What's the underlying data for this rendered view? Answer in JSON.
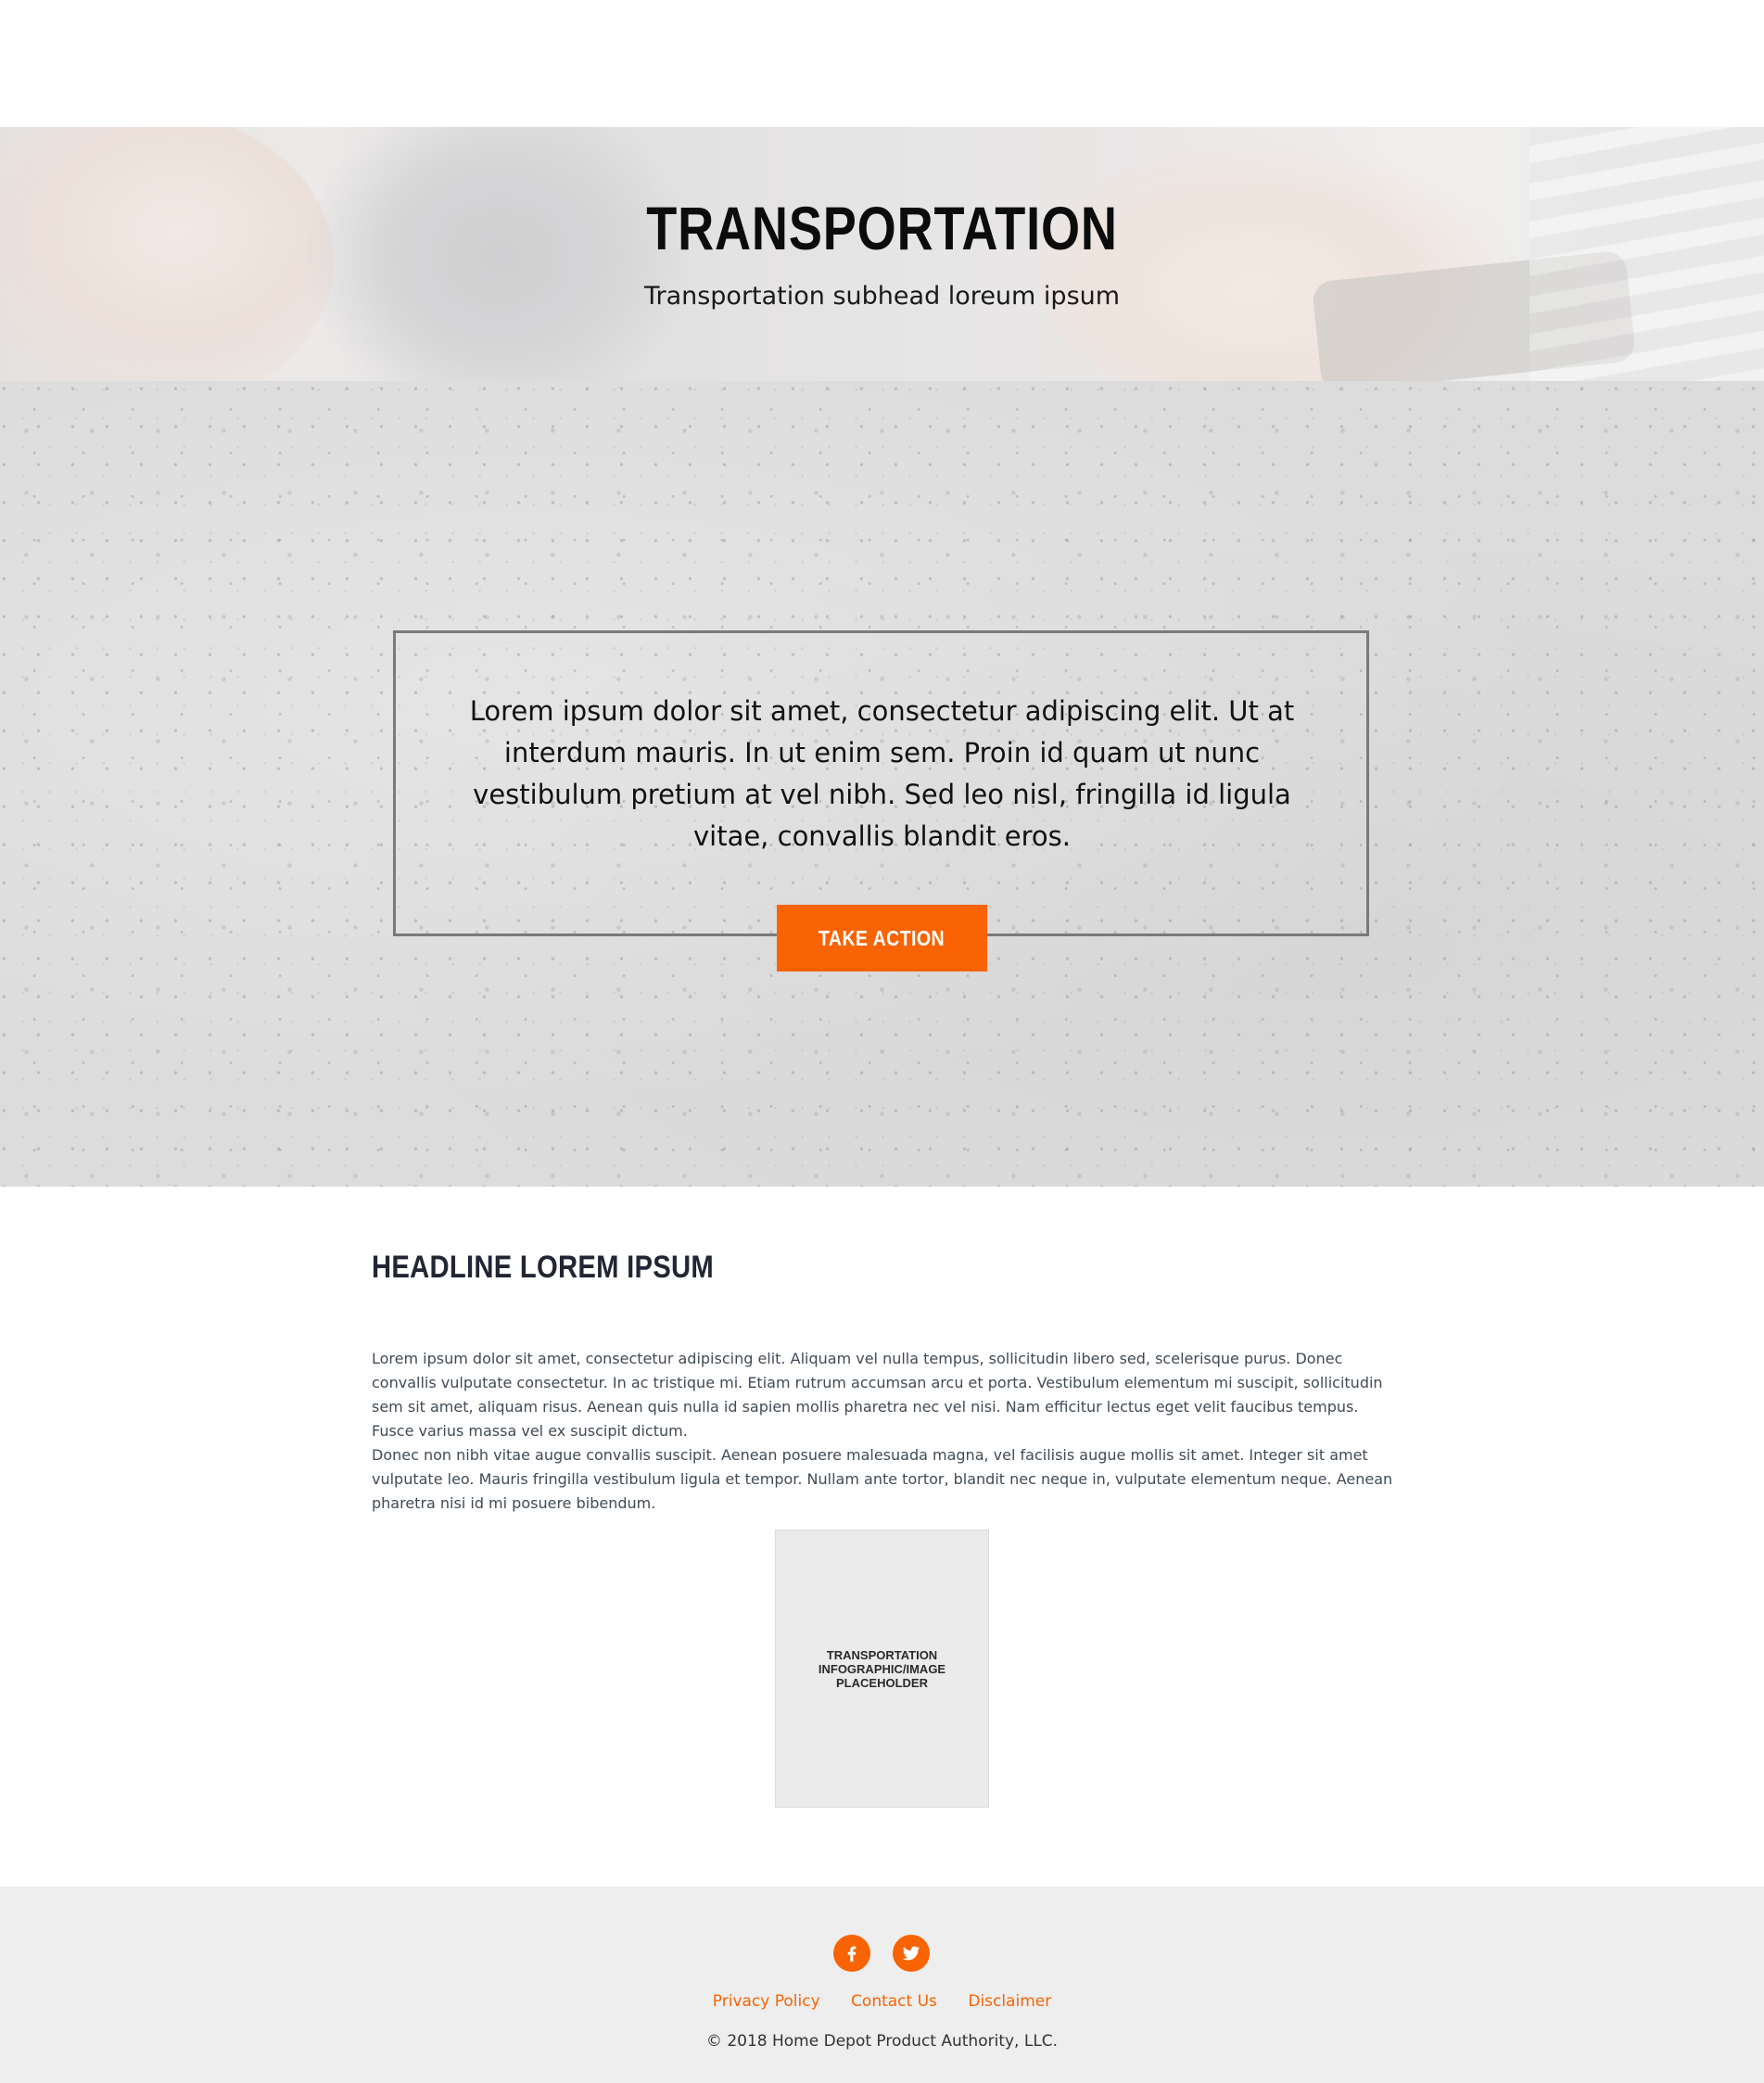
{
  "hero": {
    "title": "TRANSPORTATION",
    "subtitle": "Transportation subhead loreum ipsum"
  },
  "callout": {
    "text": "Lorem ipsum dolor sit amet, consectetur adipiscing elit. Ut at interdum mauris. In ut enim sem. Proin id quam ut nunc vestibulum pretium at vel nibh. Sed leo nisl, fringilla id ligula vitae, convallis blandit eros.",
    "button_label": "TAKE ACTION"
  },
  "content": {
    "headline": "HEADLINE LOREM IPSUM",
    "paragraphs": [
      "Lorem ipsum dolor sit amet, consectetur adipiscing elit. Aliquam vel nulla tempus, sollicitudin libero sed, scelerisque purus. Donec convallis vulputate consectetur. In ac tristique mi. Etiam rutrum accumsan arcu et porta. Vestibulum elementum mi suscipit, sollicitudin sem sit amet, aliquam risus. Aenean quis nulla id sapien mollis pharetra nec vel nisi. Nam efficitur lectus eget velit faucibus tempus. Fusce varius massa vel ex suscipit dictum.",
      "Donec non nibh vitae augue convallis suscipit. Aenean posuere malesuada magna, vel facilisis augue mollis sit amet. Integer sit amet vulputate leo. Mauris fringilla vestibulum ligula et tempor. Nullam ante tortor, blandit nec neque in, vulputate elementum neque. Aenean pharetra nisi id mi posuere bibendum."
    ],
    "image_placeholder": "TRANSPORTATION INFOGRAPHIC/IMAGE PLACEHOLDER"
  },
  "footer": {
    "social": [
      {
        "icon": "facebook-icon"
      },
      {
        "icon": "twitter-icon"
      }
    ],
    "links": [
      "Privacy Policy",
      "Contact Us",
      "Disclaimer"
    ],
    "copyright": "© 2018 Home Depot Product Authority, LLC."
  },
  "colors": {
    "accent": "#f96302",
    "footer_bg": "#eeeeee",
    "headline": "#222633"
  }
}
